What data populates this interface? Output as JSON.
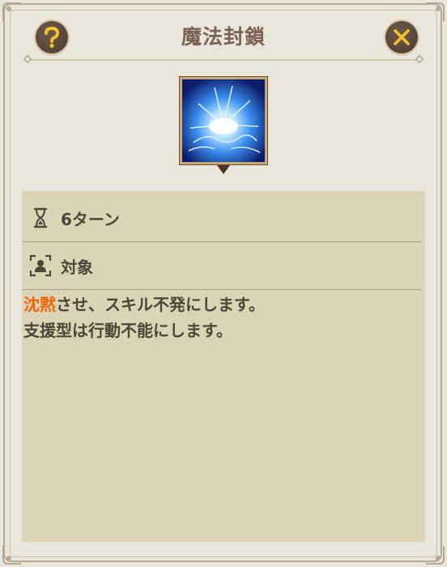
{
  "dialog": {
    "title": "魔法封鎖",
    "help_icon": "question-mark-icon",
    "close_icon": "close-x-icon",
    "skill_icon": "blue-energy-burst-icon"
  },
  "details": {
    "duration_icon": "hourglass-icon",
    "duration_label": "6ターン",
    "target_icon": "target-person-icon",
    "target_label": "対象"
  },
  "description": {
    "line1_highlight": "沈黙",
    "line1_rest": "させ、スキル不発にします。",
    "line2": "支援型は行動不能にします。"
  },
  "colors": {
    "background": "#e9e6dc",
    "panel": "#dcd4b7",
    "title": "#7b6152",
    "text": "#4f4438",
    "highlight": "#f0640a",
    "button": "#5c4a3c"
  }
}
